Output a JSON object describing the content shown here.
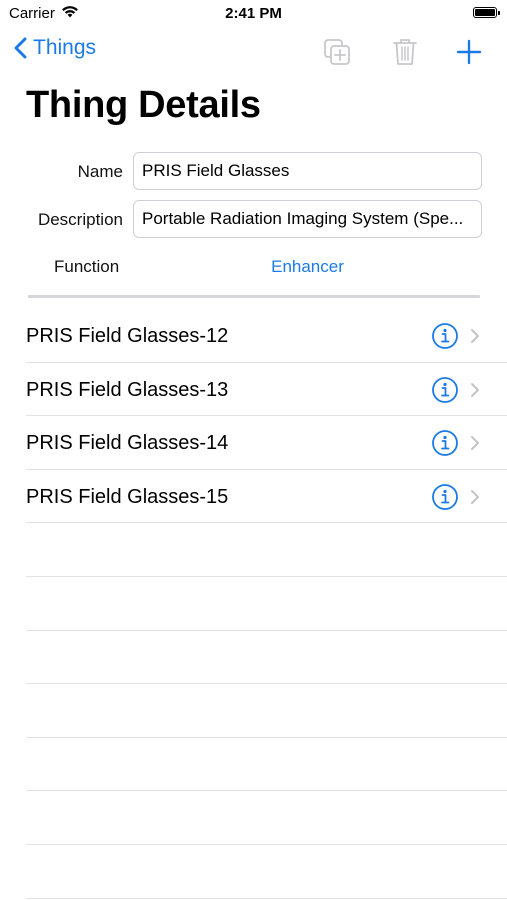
{
  "status_bar": {
    "carrier": "Carrier",
    "time": "2:41 PM"
  },
  "nav": {
    "back_label": "Things",
    "icons": [
      "duplicate-icon",
      "trash-icon",
      "plus-icon"
    ]
  },
  "title": "Thing Details",
  "form": {
    "name_label": "Name",
    "name_value": "PRIS Field Glasses",
    "description_label": "Description",
    "description_value": "Portable Radiation Imaging System (Spe...",
    "function_label": "Function",
    "function_value": "Enhancer"
  },
  "items": [
    {
      "label": "PRIS Field Glasses-12"
    },
    {
      "label": "PRIS Field Glasses-13"
    },
    {
      "label": "PRIS Field Glasses-14"
    },
    {
      "label": "PRIS Field Glasses-15"
    }
  ],
  "colors": {
    "accent": "#1a7ae6",
    "disabled_icon": "#c7c7cc",
    "separator": "#e2e2e4"
  }
}
